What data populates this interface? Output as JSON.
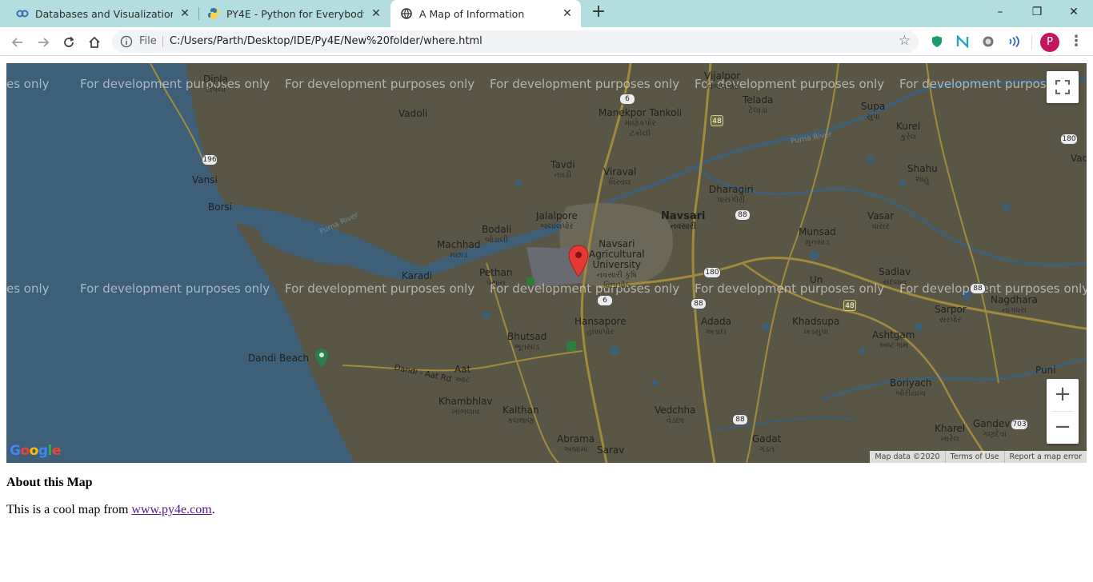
{
  "browser": {
    "tabs": [
      {
        "title": "Databases and Visualization (pee",
        "icon": "link-icon",
        "active": false
      },
      {
        "title": "PY4E - Python for Everybody",
        "icon": "python-icon",
        "active": false
      },
      {
        "title": "A Map of Information",
        "icon": "globe-icon",
        "active": true
      }
    ],
    "new_tab_label": "+",
    "address": {
      "scheme_label": "File",
      "url": "C:/Users/Parth/Desktop/IDE/Py4E/New%20folder/where.html"
    },
    "profile_initial": "P",
    "window_controls": {
      "minimize": "–",
      "restore": "❐",
      "close": "✕"
    }
  },
  "map": {
    "watermark": "For development purposes only",
    "watermark_partial": "es only",
    "watermark_partial_right": "For development purposes o",
    "places": {
      "vijalpor": {
        "name": "Vijalpor",
        "gujarati": "વિજલપોર"
      },
      "telada": {
        "name": "Telada",
        "gujarati": "ટેલાડા"
      },
      "supa": {
        "name": "Supa",
        "gujarati": "સુપા"
      },
      "kurel": {
        "name": "Kurel",
        "gujarati": "કુરેલ"
      },
      "vadoli": {
        "name": "Vadoli"
      },
      "manekpor": {
        "name": "Manekpor Tankoli",
        "gujarati1": "માણેકપોર",
        "gujarati2": "ટંકોલી"
      },
      "tavdi": {
        "name": "Tavdi",
        "gujarati": "તવડી"
      },
      "viraval": {
        "name": "Viraval",
        "gujarati": "વિરવલ"
      },
      "dharagiri": {
        "name": "Dharagiri",
        "gujarati": "ધારાગીરી"
      },
      "shahu": {
        "name": "Shahu",
        "gujarati": "શાહુ"
      },
      "vansi": {
        "name": "Vansi"
      },
      "borsi": {
        "name": "Borsi"
      },
      "jalalpore": {
        "name": "Jalalpore",
        "gujarati": "જલાલપોર"
      },
      "navsari": {
        "name": "Navsari",
        "gujarati": "નવસારી"
      },
      "vasar": {
        "name": "Vasar",
        "gujarati": "વાસર"
      },
      "bodali": {
        "name": "Bodali",
        "gujarati": "બોડાલી"
      },
      "machhad": {
        "name": "Machhad",
        "gujarati": "મછાડ"
      },
      "munsad": {
        "name": "Munsad",
        "gujarati": "મુનસાડ"
      },
      "university": {
        "name1": "Navsari",
        "name2": "Agricultural",
        "name3": "University",
        "gujarati1": "નવસારી કૃષિ",
        "gujarati2": "વિદ્યાપીઠ"
      },
      "karadi": {
        "name": "Karadi"
      },
      "pethan": {
        "name": "Pethan",
        "gujarati": "પેથાન"
      },
      "sadlav": {
        "name": "Sadlav",
        "gujarati": "સદલાવ"
      },
      "un": {
        "name": "Un"
      },
      "sarpor": {
        "name": "Sarpor",
        "gujarati": "સરપોર"
      },
      "nagdhara": {
        "name": "Nagdhara",
        "gujarati": "નાગધરા"
      },
      "hansapore": {
        "name": "Hansapore",
        "gujarati": "હાંસાપોર"
      },
      "adada": {
        "name": "Adada",
        "gujarati": "અડાદા"
      },
      "khadsupa": {
        "name": "Khadsupa",
        "gujarati": "ખડસુપા"
      },
      "ashtgam": {
        "name": "Ashtgam",
        "gujarati": "અષ્ટગામ"
      },
      "bhutsad": {
        "name": "Bhutsad",
        "gujarati": "ભૂતસાડ"
      },
      "dandi_beach": {
        "name": "Dandi Beach"
      },
      "aat": {
        "name": "Aat",
        "gujarati": "આટ"
      },
      "dandi_road": {
        "name": "Dandi - Aat Rd"
      },
      "puni": {
        "name": "Puni"
      },
      "boriyach": {
        "name": "Boriyach",
        "gujarati": "બોરીયાચ"
      },
      "khambhlav": {
        "name": "Khambhlav",
        "gujarati": "ખાંભલાવ"
      },
      "kalthan": {
        "name": "Kalthan",
        "gujarati": "કલથાણ"
      },
      "vedchha": {
        "name": "Vedchha",
        "gujarati": "વેડછા"
      },
      "kharel": {
        "name": "Kharel",
        "gujarati": "ખારેલ"
      },
      "gandeva": {
        "name": "Gandeva",
        "gujarati": "ગણદેવા"
      },
      "gadat": {
        "name": "Gadat",
        "gujarati": "ગડત"
      },
      "abrama": {
        "name": "Abrama",
        "gujarati": "અબ્રામા"
      },
      "sarav": {
        "name": "Sarav"
      },
      "purna_river": {
        "name": "Purna River"
      },
      "vad": {
        "name": "Vad"
      },
      "dipla": {
        "name": "Dipla",
        "gujarati": "દીપલા"
      }
    },
    "highway_labels": {
      "nh6": "6",
      "nh48": "48",
      "nh88": "88",
      "nh180": "180",
      "nh196": "196",
      "nh703": "703"
    },
    "footer": {
      "map_data": "Map data ©2020",
      "terms": "Terms of Use",
      "report": "Report a map error"
    },
    "google_logo": "Google",
    "zoom_in": "+",
    "zoom_out": "−",
    "colors": {
      "land": "#5a5646",
      "water": "#3e5f78",
      "roads": "#a08a3c",
      "marker": "#e53935"
    }
  },
  "content": {
    "heading": "About this Map",
    "text_prefix": "This is a cool map from ",
    "link_text": "www.py4e.com",
    "text_suffix": "."
  }
}
